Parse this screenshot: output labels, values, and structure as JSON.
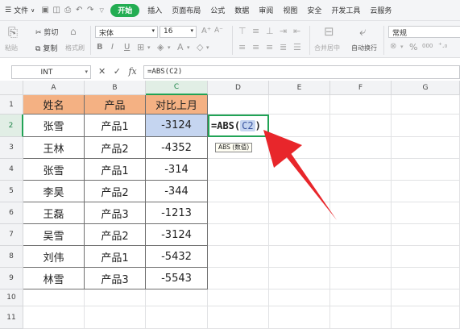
{
  "menubar": {
    "items": [
      "文件",
      "插入",
      "页面布局",
      "公式",
      "数据",
      "审阅",
      "视图",
      "安全",
      "开发工具",
      "云服务"
    ],
    "active_tab": "开始"
  },
  "ribbon": {
    "cut": "剪切",
    "paste": "粘贴",
    "copy": "复制",
    "format_painter": "格式刷",
    "font_name": "宋体",
    "font_size": "16",
    "merge_center": "合并居中",
    "wrap_text": "自动换行",
    "number_format": "常规",
    "bold": "B",
    "italic": "I",
    "underline": "U",
    "increase_font": "A⁺",
    "decrease_font": "A⁻",
    "percent": "%",
    "thousands": "000"
  },
  "formula_bar": {
    "name_box": "INT",
    "cancel": "✕",
    "enter": "✓",
    "fx": "fx",
    "formula": "=ABS(C2)"
  },
  "sheet": {
    "columns": [
      "A",
      "B",
      "C",
      "D",
      "E",
      "F",
      "G"
    ],
    "rows": [
      "1",
      "2",
      "3",
      "4",
      "5",
      "6",
      "7",
      "8",
      "9",
      "10",
      "11"
    ],
    "header": [
      "姓名",
      "产品",
      "对比上月"
    ],
    "data": [
      [
        "张雪",
        "产品1",
        "-3124"
      ],
      [
        "王林",
        "产品2",
        "-4352"
      ],
      [
        "张雪",
        "产品1",
        "-314"
      ],
      [
        "李昊",
        "产品2",
        "-344"
      ],
      [
        "王磊",
        "产品3",
        "-1213"
      ],
      [
        "吴雪",
        "产品2",
        "-3124"
      ],
      [
        "刘伟",
        "产品1",
        "-5432"
      ],
      [
        "林雪",
        "产品3",
        "-5543"
      ]
    ],
    "edit_cell": {
      "prefix": "=ABS(",
      "ref": "C2",
      "suffix": ")"
    },
    "tooltip": "ABS (数值)"
  },
  "colors": {
    "accent_green": "#23ad52",
    "header_fill": "#f4b183",
    "selection_fill": "#c5d5f0",
    "arrow_red": "#e8262b"
  }
}
